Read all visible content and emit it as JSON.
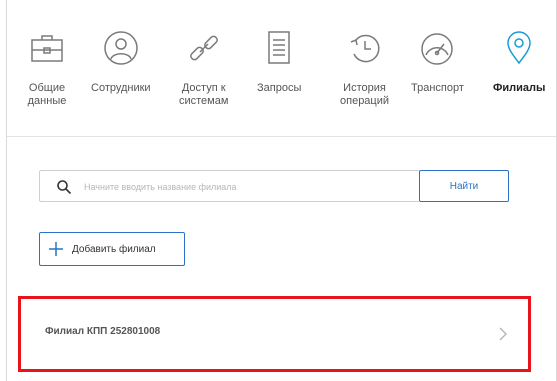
{
  "nav": {
    "items": [
      {
        "label": "Общие\nданные",
        "icon": "briefcase-icon"
      },
      {
        "label": "Сотрудники",
        "icon": "user-icon"
      },
      {
        "label": "Доступ к\nсистемам",
        "icon": "link-icon"
      },
      {
        "label": "Запросы",
        "icon": "document-icon"
      },
      {
        "label": "История\nопераций",
        "icon": "history-icon"
      },
      {
        "label": "Транспорт",
        "icon": "speedometer-icon"
      },
      {
        "label": "Филиалы",
        "icon": "location-pin-icon"
      }
    ],
    "active_index": 6
  },
  "search": {
    "placeholder": "Начните вводить название филиала",
    "value": "",
    "button_label": "Найти"
  },
  "add_branch": {
    "label": "Добавить филиал"
  },
  "branches": [
    {
      "name": "Филиал КПП 252801008"
    }
  ],
  "colors": {
    "accent": "#2b72c6",
    "active_icon": "#1a9bd7",
    "highlight_border": "#e8141b"
  }
}
